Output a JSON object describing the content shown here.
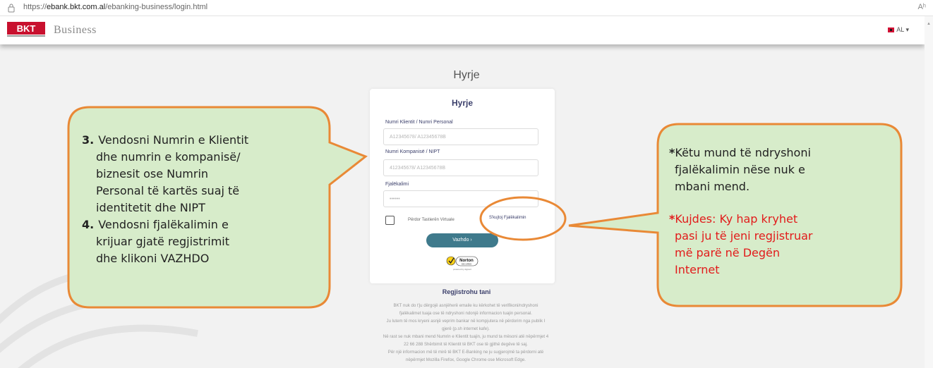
{
  "browser": {
    "url_prefix": "https://",
    "url_domain": "ebank.bkt.com.al",
    "url_path": "/ebanking-business/login.html",
    "reader_icon": "Aʰ"
  },
  "header": {
    "logo_text": "BKT",
    "business_label": "Business",
    "language": "AL ▾"
  },
  "login": {
    "page_heading": "Hyrje",
    "card_title": "Hyrje",
    "client_label": "Numri Klientit / Numri Personal",
    "client_placeholder": "A12345678/ A12345678B",
    "company_label": "Numri Kompanisë / NIPT",
    "company_placeholder": "412345678/ A12345678B",
    "password_label": "Fjalëkalimi",
    "password_placeholder": "••••••",
    "virtual_keyboard_label": "Përdor Tastierën Virtuale",
    "forgot_password": "S'kujtoj Fjalëkalimin",
    "continue_button": "Vazhdo ›",
    "norton_label": "Norton",
    "norton_secured": "SECURED",
    "norton_powered": "powered by digicert",
    "register_link": "Regjistrohu tani"
  },
  "notice": [
    "BKT nuk do t'ju dërgojë asnjëherë emaile ku kërkohet të verifikoni/ndryshoni",
    "fjalëkalimet tuaja ose të ndryshoni ndonjë informacion tuajin personal.",
    "Ju lutem të mos kryeni asnjë veprim bankar në kompjutera në përdorim nga publik I",
    "gjerë (p.sh internet kafe).",
    "Në rast se nuk mbani mend Numrin e Klientit tuajin, ju mund ta mësoni atë nëpërmjet 4",
    "22 66 288 Shërbimit të Klientit të BKT ose të gjithë degëve të saj.",
    "Për një informacion më të mirë të BKT E-Banking ne ju sugjerojmë ta përdorni atë",
    "nëpërmjet Mozilla Firefox, Google Chrome ose Microsoft Edge."
  ],
  "callout_left": {
    "step3_number": "3.",
    "step3_lines": [
      "Vendosni Numrin e Klientit",
      "dhe numrin e kompanisë/",
      "biznesit ose Numrin",
      "Personal të kartës suaj të",
      "identitetit dhe NIPT"
    ],
    "step4_number": "4.",
    "step4_lines": [
      "Vendosni fjalëkalimin e",
      "krijuar gjatë regjistrimit",
      "dhe klikoni VAZHDO"
    ]
  },
  "callout_right": {
    "star": "*",
    "note_lines": [
      "Këtu mund të ndryshoni",
      "fjalëkalimin nëse nuk e",
      "mbani mend."
    ],
    "warning_lines": [
      "Kujdes: Ky hap kryhet",
      "pasi ju të jeni regjistruar",
      "më parë në Degën",
      "Internet"
    ]
  },
  "colors": {
    "callout_fill": "#d7ecca",
    "callout_border": "#e98936",
    "warning_text": "#e21b1b",
    "brand_navy": "#3b3f6b",
    "button_teal": "#3f7a8c"
  }
}
